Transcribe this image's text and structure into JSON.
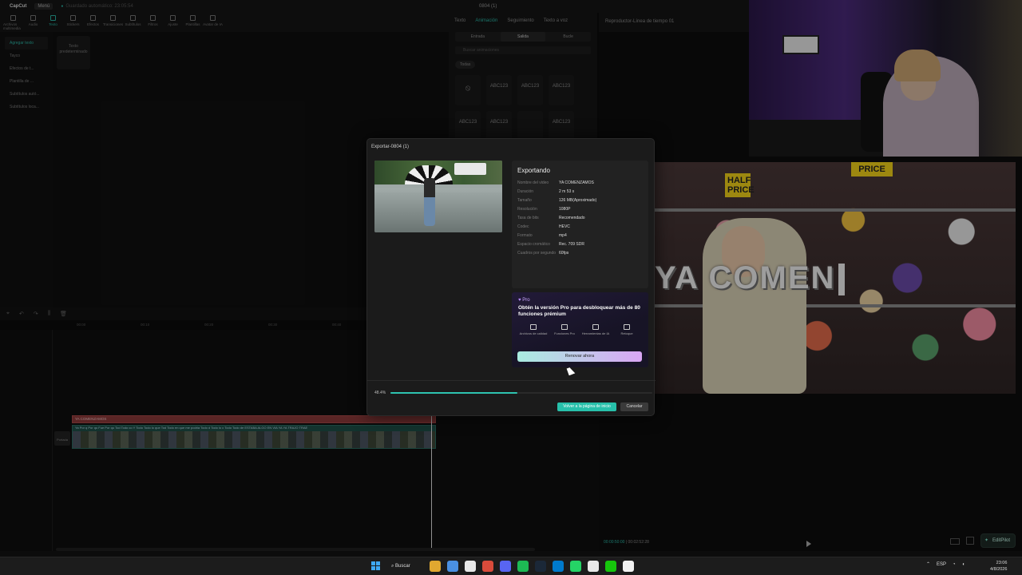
{
  "app": {
    "logo": "CapCut",
    "menu": "Menú",
    "saved": "Guardado automático: 23:05:54",
    "project_title": "0804 (1)"
  },
  "toolbar": [
    {
      "label": "Archivos multimedia"
    },
    {
      "label": "Audio"
    },
    {
      "label": "Texto",
      "active": true
    },
    {
      "label": "Stickers"
    },
    {
      "label": "Efectos"
    },
    {
      "label": "Transiciones"
    },
    {
      "label": "Subtítulos"
    },
    {
      "label": "Filtros"
    },
    {
      "label": "Ajuste"
    },
    {
      "label": "Plantillas"
    },
    {
      "label": "Avatar de IA"
    }
  ],
  "left_panel": [
    "Agregar texto",
    "Tayco",
    "Efectos de t...",
    "Plantilla de ...",
    "Subtítulos autó...",
    "Subtítulos loca..."
  ],
  "media_card": "Texto predeterminado",
  "properties": {
    "tabs": [
      "Texto",
      "Animación",
      "Seguimiento",
      "Texto a voz"
    ],
    "active_tab": "Animación",
    "subtabs": [
      "Entrada",
      "Salida",
      "Bucle"
    ],
    "search_placeholder": "Buscar animaciones",
    "chip": "Todas",
    "cells": [
      "",
      "ABC123",
      "ABC123",
      "ABC123",
      "ABC123",
      "ABC123",
      "",
      "ABC123"
    ]
  },
  "player_header": "Reproductor-Línea de tiempo 01",
  "timeline": {
    "text_clip": "YA COMENZAMOS",
    "video_labels": "Ya  Por q  Por qu  Fue  Por qu  Tod  Todo co  Y  Todo   Todo lo que  Tod  Todo en que me podria  Todo d  Todo lo c  Todo  Todo de  ESTABA  ALGO EN  VIA  YA  YA TRAJO  TRAE",
    "cover": "Portada",
    "ruler": [
      "00:00",
      "00:10",
      "00:20",
      "00:30",
      "00:40"
    ]
  },
  "preview": {
    "overlay_text": "YA COMEN",
    "sign_1": "HALF PRICE",
    "sign_2": "PRICE",
    "time_current": "00:00:50:00",
    "time_total": "00:02:52:28"
  },
  "editpilot": "EditPilot",
  "modal": {
    "title": "Exportar-0804 (1)",
    "heading": "Exportando",
    "rows": [
      {
        "k": "Nombre del video",
        "v": "YA COMENZAMOS"
      },
      {
        "k": "Duración",
        "v": "2 m 53 s"
      },
      {
        "k": "Tamaño",
        "v": "126 MB(Aproximado)"
      },
      {
        "k": "Resolución",
        "v": "1080P"
      },
      {
        "k": "Tasa de bits",
        "v": "Recomendado"
      },
      {
        "k": "Codec",
        "v": "HEVC"
      },
      {
        "k": "Formato",
        "v": "mp4"
      },
      {
        "k": "Espacio cromático",
        "v": "Rec. 709 SDR"
      },
      {
        "k": "Cuadros por segundo",
        "v": "60fps"
      }
    ],
    "pro_badge": "Pro",
    "pro_text": "Obtén la versión Pro para desbloquear más de 80 funciones prémium",
    "features": [
      "Archivos de calidad",
      "Funciones Pro",
      "Herramientas de IA",
      "Retoque"
    ],
    "renew": "Renovar ahora",
    "progress_label": "48.4%",
    "progress_value": 0.484,
    "home_button": "Volver a la página de inicio",
    "cancel_button": "Cancelar"
  },
  "taskbar": {
    "search": "Buscar",
    "language": "ESP",
    "time": "23:06",
    "date": "4/8/2026",
    "app_colors": [
      "#e0a830",
      "#4a90e2",
      "#e8e8e8",
      "#d94b3b",
      "#5865f2",
      "#1db954",
      "#1b2838",
      "#007acc",
      "#25d366",
      "#e8e8e8",
      "#16c60c",
      "#f2f2f2"
    ]
  }
}
